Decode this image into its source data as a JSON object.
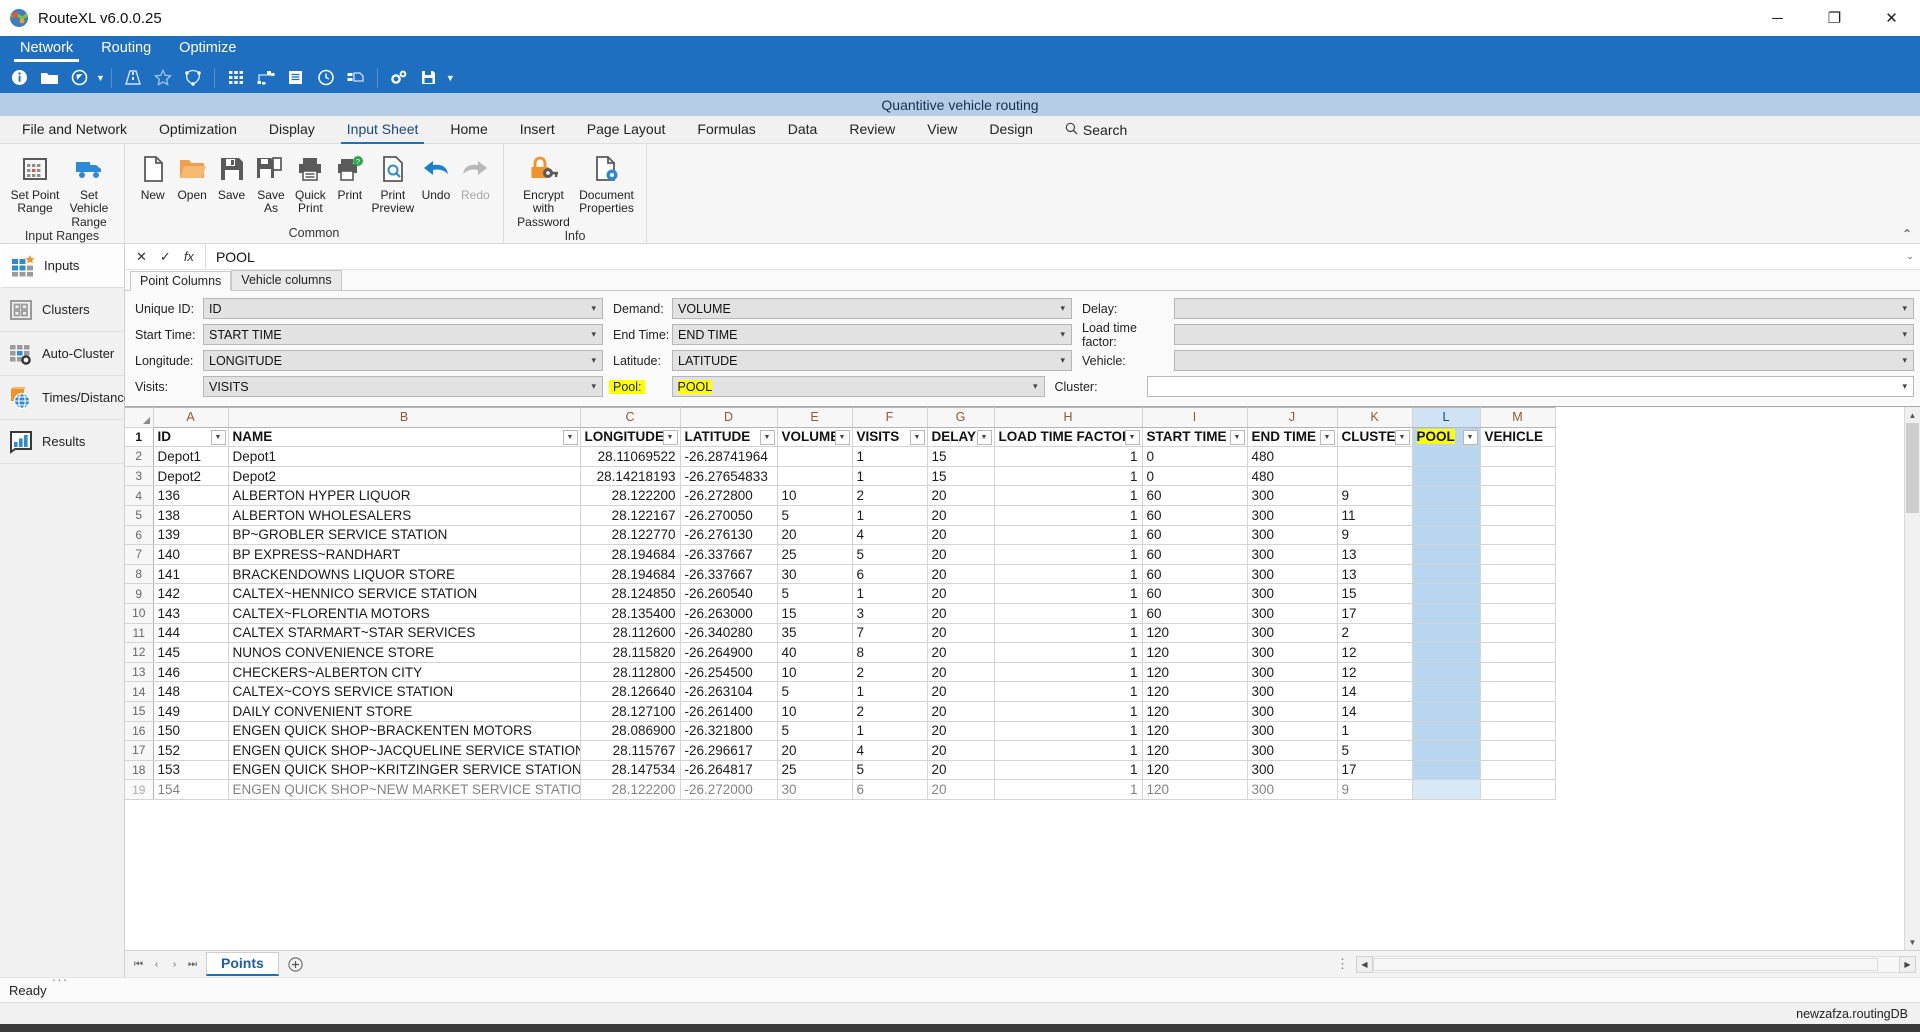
{
  "window": {
    "app_title": "RouteXL v6.0.0.25",
    "minimize": "─",
    "maximize": "❐",
    "close": "✕"
  },
  "blue_menu": {
    "items": [
      {
        "label": "Network",
        "active": true
      },
      {
        "label": "Routing",
        "active": false
      },
      {
        "label": "Optimize",
        "active": false
      }
    ]
  },
  "blue_toolbar": {
    "icons": [
      "info-icon",
      "folder-icon",
      "compass-icon",
      "chevron-down-icon",
      "road-icon",
      "star-icon",
      "polygon-icon",
      "grid-matrix-icon",
      "network-nodes-icon",
      "document-list-icon",
      "clock-icon",
      "truck-list-icon",
      "settings-gears-icon",
      "save-icon",
      "chevron-down-icon"
    ]
  },
  "doc_title": "Quantitive vehicle routing",
  "ribbon_tabs": {
    "items": [
      {
        "label": "File and Network",
        "active": false
      },
      {
        "label": "Optimization",
        "active": false
      },
      {
        "label": "Display",
        "active": false
      },
      {
        "label": "Input Sheet",
        "active": true
      },
      {
        "label": "Home",
        "active": false
      },
      {
        "label": "Insert",
        "active": false
      },
      {
        "label": "Page Layout",
        "active": false
      },
      {
        "label": "Formulas",
        "active": false
      },
      {
        "label": "Data",
        "active": false
      },
      {
        "label": "Review",
        "active": false
      },
      {
        "label": "View",
        "active": false
      },
      {
        "label": "Design",
        "active": false
      }
    ],
    "search_label": "Search"
  },
  "ribbon": {
    "groups": [
      {
        "name": "Input Ranges",
        "label": "Input Ranges",
        "buttons": [
          {
            "label": "Set Point Range",
            "icon": "point-range-grid-icon",
            "disabled": false
          },
          {
            "label": "Set Vehicle Range",
            "icon": "vehicle-truck-icon",
            "disabled": false
          }
        ]
      },
      {
        "name": "Common",
        "label": "Common",
        "buttons": [
          {
            "label": "New",
            "icon": "new-document-icon",
            "disabled": false
          },
          {
            "label": "Open",
            "icon": "open-folder-icon",
            "disabled": false
          },
          {
            "label": "Save",
            "icon": "save-floppy-icon",
            "disabled": false
          },
          {
            "label": "Save As",
            "icon": "save-as-icon",
            "disabled": false
          },
          {
            "label": "Quick Print",
            "icon": "quick-print-icon",
            "disabled": false
          },
          {
            "label": "Print",
            "icon": "print-help-icon",
            "disabled": false
          },
          {
            "label": "Print Preview",
            "icon": "print-preview-icon",
            "disabled": false
          },
          {
            "label": "Undo",
            "icon": "undo-arrow-icon",
            "disabled": false
          },
          {
            "label": "Redo",
            "icon": "redo-arrow-icon",
            "disabled": true
          }
        ]
      },
      {
        "name": "Info",
        "label": "Info",
        "buttons": [
          {
            "label": "Encrypt with Password",
            "icon": "lock-key-icon",
            "disabled": false
          },
          {
            "label": "Document Properties",
            "icon": "document-properties-icon",
            "disabled": false
          }
        ]
      }
    ],
    "collapse": "⌃"
  },
  "left_nav": {
    "items": [
      {
        "label": "Inputs",
        "icon": "inputs-grid-star-icon",
        "active": true
      },
      {
        "label": "Clusters",
        "icon": "clusters-squares-icon",
        "active": false
      },
      {
        "label": "Auto-Cluster",
        "icon": "auto-cluster-gear-icon",
        "active": false
      },
      {
        "label": "Times/Distances",
        "icon": "times-distances-globe-icon",
        "active": false
      },
      {
        "label": "Results",
        "icon": "results-chart-icon",
        "active": false
      }
    ]
  },
  "formula_bar": {
    "cancel": "✕",
    "accept": "✓",
    "function": "fx",
    "value": "POOL",
    "expand": "⌄"
  },
  "panel_tabs": {
    "items": [
      {
        "label": "Point Columns",
        "active": true
      },
      {
        "label": "Vehicle columns",
        "active": false
      }
    ]
  },
  "fields": [
    {
      "label": "Unique ID:",
      "value": "ID",
      "name": "unique-id",
      "highlight": false,
      "empty": false,
      "white": false
    },
    {
      "label": "Demand:",
      "value": "VOLUME",
      "name": "demand",
      "highlight": false,
      "empty": false,
      "white": false
    },
    {
      "label": "Delay:",
      "value": "",
      "name": "delay",
      "highlight": false,
      "empty": true,
      "white": false
    },
    {
      "label": "Start Time:",
      "value": "START TIME",
      "name": "start-time",
      "highlight": false,
      "empty": false,
      "white": false
    },
    {
      "label": "End Time:",
      "value": "END TIME",
      "name": "end-time",
      "highlight": false,
      "empty": false,
      "white": false
    },
    {
      "label": "Load time factor:",
      "value": "",
      "name": "load-time-factor",
      "highlight": false,
      "empty": true,
      "white": false
    },
    {
      "label": "Longitude:",
      "value": "LONGITUDE",
      "name": "longitude",
      "highlight": false,
      "empty": false,
      "white": false
    },
    {
      "label": "Latitude:",
      "value": "LATITUDE",
      "name": "latitude",
      "highlight": false,
      "empty": false,
      "white": false
    },
    {
      "label": "Vehicle:",
      "value": "",
      "name": "vehicle",
      "highlight": false,
      "empty": true,
      "white": false
    },
    {
      "label": "Visits:",
      "value": "VISITS",
      "name": "visits",
      "highlight": false,
      "empty": false,
      "white": false
    },
    {
      "label": "Pool:",
      "value": "POOL",
      "name": "pool",
      "highlight": true,
      "empty": false,
      "white": false
    },
    {
      "label": "Cluster:",
      "value": "",
      "name": "cluster",
      "highlight": false,
      "empty": true,
      "white": true
    }
  ],
  "sheet": {
    "column_letters": [
      "A",
      "B",
      "C",
      "D",
      "E",
      "F",
      "G",
      "H",
      "I",
      "J",
      "K",
      "L",
      "M"
    ],
    "selected_column_letter": "L",
    "headers": [
      "ID",
      "NAME",
      "LONGITUDE",
      "LATITUDE",
      "VOLUME",
      "VISITS",
      "DELAY",
      "LOAD TIME FACTOR",
      "START TIME",
      "END TIME",
      "CLUSTER",
      "POOL",
      "VEHICLE"
    ],
    "header_row_number": "1",
    "rows": [
      {
        "n": "2",
        "cells": [
          "Depot1",
          "Depot1",
          "28.11069522",
          "-26.28741964",
          "",
          "1",
          "15",
          "1",
          "0",
          "480",
          "",
          "",
          ""
        ]
      },
      {
        "n": "3",
        "cells": [
          "Depot2",
          "Depot2",
          "28.14218193",
          "-26.27654833",
          "",
          "1",
          "15",
          "1",
          "0",
          "480",
          "",
          "",
          ""
        ]
      },
      {
        "n": "4",
        "cells": [
          "136",
          "ALBERTON HYPER LIQUOR",
          "28.122200",
          "-26.272800",
          "10",
          "2",
          "20",
          "1",
          "60",
          "300",
          "9",
          "",
          ""
        ]
      },
      {
        "n": "5",
        "cells": [
          "138",
          "ALBERTON WHOLESALERS",
          "28.122167",
          "-26.270050",
          "5",
          "1",
          "20",
          "1",
          "60",
          "300",
          "11",
          "",
          ""
        ]
      },
      {
        "n": "6",
        "cells": [
          "139",
          "BP~GROBLER SERVICE STATION",
          "28.122770",
          "-26.276130",
          "20",
          "4",
          "20",
          "1",
          "60",
          "300",
          "9",
          "",
          ""
        ]
      },
      {
        "n": "7",
        "cells": [
          "140",
          "BP EXPRESS~RANDHART",
          "28.194684",
          "-26.337667",
          "25",
          "5",
          "20",
          "1",
          "60",
          "300",
          "13",
          "",
          ""
        ]
      },
      {
        "n": "8",
        "cells": [
          "141",
          "BRACKENDOWNS LIQUOR STORE",
          "28.194684",
          "-26.337667",
          "30",
          "6",
          "20",
          "1",
          "60",
          "300",
          "13",
          "",
          ""
        ]
      },
      {
        "n": "9",
        "cells": [
          "142",
          "CALTEX~HENNICO SERVICE STATION",
          "28.124850",
          "-26.260540",
          "5",
          "1",
          "20",
          "1",
          "60",
          "300",
          "15",
          "",
          ""
        ]
      },
      {
        "n": "10",
        "cells": [
          "143",
          "CALTEX~FLORENTIA MOTORS",
          "28.135400",
          "-26.263000",
          "15",
          "3",
          "20",
          "1",
          "60",
          "300",
          "17",
          "",
          ""
        ]
      },
      {
        "n": "11",
        "cells": [
          "144",
          "CALTEX STARMART~STAR SERVICES",
          "28.112600",
          "-26.340280",
          "35",
          "7",
          "20",
          "1",
          "120",
          "300",
          "2",
          "",
          ""
        ]
      },
      {
        "n": "12",
        "cells": [
          "145",
          "NUNOS CONVENIENCE STORE",
          "28.115820",
          "-26.264900",
          "40",
          "8",
          "20",
          "1",
          "120",
          "300",
          "12",
          "",
          ""
        ]
      },
      {
        "n": "13",
        "cells": [
          "146",
          "CHECKERS~ALBERTON CITY",
          "28.112800",
          "-26.254500",
          "10",
          "2",
          "20",
          "1",
          "120",
          "300",
          "12",
          "",
          ""
        ]
      },
      {
        "n": "14",
        "cells": [
          "148",
          "CALTEX~COYS SERVICE STATION",
          "28.126640",
          "-26.263104",
          "5",
          "1",
          "20",
          "1",
          "120",
          "300",
          "14",
          "",
          ""
        ]
      },
      {
        "n": "15",
        "cells": [
          "149",
          "DAILY CONVENIENT STORE",
          "28.127100",
          "-26.261400",
          "10",
          "2",
          "20",
          "1",
          "120",
          "300",
          "14",
          "",
          ""
        ]
      },
      {
        "n": "16",
        "cells": [
          "150",
          "ENGEN QUICK SHOP~BRACKENTEN MOTORS",
          "28.086900",
          "-26.321800",
          "5",
          "1",
          "20",
          "1",
          "120",
          "300",
          "1",
          "",
          ""
        ]
      },
      {
        "n": "17",
        "cells": [
          "152",
          "ENGEN QUICK SHOP~JACQUELINE SERVICE STATION",
          "28.115767",
          "-26.296617",
          "20",
          "4",
          "20",
          "1",
          "120",
          "300",
          "5",
          "",
          ""
        ]
      },
      {
        "n": "18",
        "cells": [
          "153",
          "ENGEN QUICK SHOP~KRITZINGER SERVICE STATION",
          "28.147534",
          "-26.264817",
          "25",
          "5",
          "20",
          "1",
          "120",
          "300",
          "17",
          "",
          ""
        ]
      },
      {
        "n": "19",
        "cells": [
          "154",
          "ENGEN QUICK SHOP~NEW MARKET SERVICE STATION",
          "28.122200",
          "-26.272000",
          "30",
          "6",
          "20",
          "1",
          "120",
          "300",
          "9",
          "",
          ""
        ]
      }
    ]
  },
  "sheet_tabs": {
    "first": "⏮",
    "prev": "‹",
    "next": "›",
    "last": "⏭",
    "active_sheet": "Points",
    "add": "+",
    "dots": "⋮",
    "scroll_left": "◀",
    "scroll_right": "▶",
    "ellipsis": "..."
  },
  "status_bar": {
    "text": "Ready"
  },
  "db_bar": {
    "text": "newzafza.routingDB"
  },
  "colors": {
    "accent_blue": "#1f6fc0",
    "highlight_yellow": "#ffff00",
    "selection_blue": "#b8d6f0",
    "orange": "#ef8c2c"
  }
}
